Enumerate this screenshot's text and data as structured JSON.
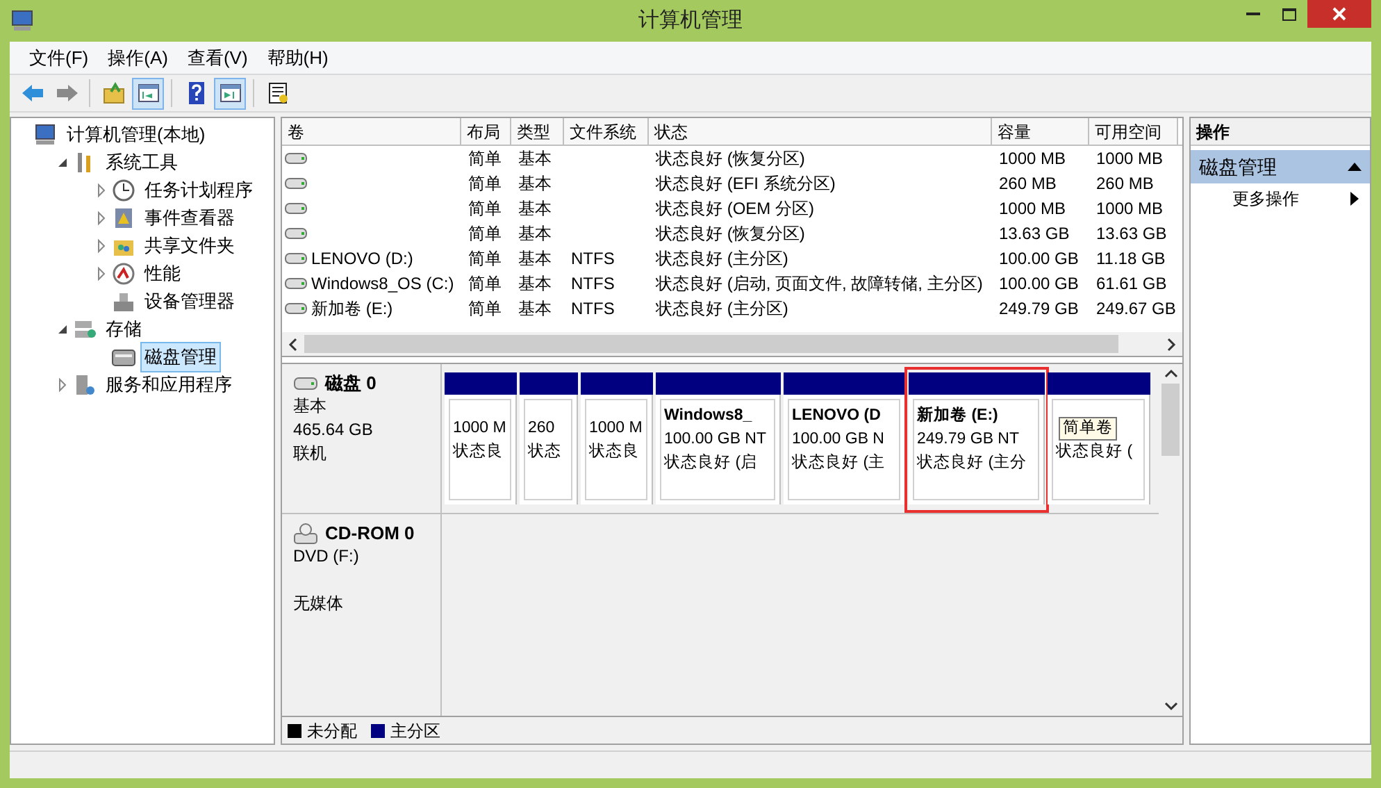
{
  "window": {
    "title": "计算机管理"
  },
  "menu": [
    "文件(F)",
    "操作(A)",
    "查看(V)",
    "帮助(H)"
  ],
  "toolbar": [
    {
      "kind": "back",
      "pressed": false
    },
    {
      "kind": "forward",
      "pressed": false
    },
    {
      "kind": "sep"
    },
    {
      "kind": "up",
      "pressed": false
    },
    {
      "kind": "tree",
      "pressed": true
    },
    {
      "kind": "sep"
    },
    {
      "kind": "help",
      "pressed": false
    },
    {
      "kind": "pane",
      "pressed": true
    },
    {
      "kind": "sep"
    },
    {
      "kind": "export",
      "pressed": false
    }
  ],
  "tree": [
    {
      "label": "计算机管理(本地)",
      "selected": false,
      "children": [
        {
          "label": "系统工具",
          "selected": false,
          "expanded": true,
          "children": [
            {
              "label": "任务计划程序",
              "selected": false,
              "expanded": false
            },
            {
              "label": "事件查看器",
              "selected": false,
              "expanded": false
            },
            {
              "label": "共享文件夹",
              "selected": false,
              "expanded": false
            },
            {
              "label": "性能",
              "selected": false,
              "expanded": false
            },
            {
              "label": "设备管理器",
              "selected": false
            }
          ]
        },
        {
          "label": "存储",
          "selected": false,
          "expanded": true,
          "children": [
            {
              "label": "磁盘管理",
              "selected": true
            }
          ]
        },
        {
          "label": "服务和应用程序",
          "selected": false,
          "expanded": false
        }
      ]
    }
  ],
  "volumes": {
    "columns": [
      "卷",
      "布局",
      "类型",
      "文件系统",
      "状态",
      "容量",
      "可用空间"
    ],
    "rows": [
      [
        "",
        "简单",
        "基本",
        "",
        "状态良好 (恢复分区)",
        "1000 MB",
        "1000 MB"
      ],
      [
        "",
        "简单",
        "基本",
        "",
        "状态良好 (EFI 系统分区)",
        "260 MB",
        "260 MB"
      ],
      [
        "",
        "简单",
        "基本",
        "",
        "状态良好 (OEM 分区)",
        "1000 MB",
        "1000 MB"
      ],
      [
        "",
        "简单",
        "基本",
        "",
        "状态良好 (恢复分区)",
        "13.63 GB",
        "13.63 GB"
      ],
      [
        "LENOVO (D:)",
        "简单",
        "基本",
        "NTFS",
        "状态良好 (主分区)",
        "100.00 GB",
        "11.18 GB"
      ],
      [
        "Windows8_OS (C:)",
        "简单",
        "基本",
        "NTFS",
        "状态良好 (启动, 页面文件, 故障转储, 主分区)",
        "100.00 GB",
        "61.61 GB"
      ],
      [
        "新加卷 (E:)",
        "简单",
        "基本",
        "NTFS",
        "状态良好 (主分区)",
        "249.79 GB",
        "249.67 GB"
      ]
    ]
  },
  "disks": [
    {
      "kind": "hdd",
      "name": "磁盘 0",
      "type": "基本",
      "size": "465.64 GB",
      "status": "联机",
      "partitions": [
        {
          "size": "1000 M",
          "status": "状态良",
          "highlighted": false
        },
        {
          "size": "260",
          "status": "状态",
          "highlighted": false
        },
        {
          "size": "1000 M",
          "status": "状态良",
          "highlighted": false
        },
        {
          "name": "Windows8_",
          "size": "100.00 GB NT",
          "status": "状态良好 (启",
          "highlighted": false
        },
        {
          "name": "LENOVO (D",
          "size": "100.00 GB N",
          "status": "状态良好 (主",
          "highlighted": false
        },
        {
          "name": "新加卷 (E:)",
          "size": "249.79 GB NT",
          "status": "状态良好 (主分",
          "highlighted": true
        },
        {
          "status": "状态良好 (",
          "highlighted": false,
          "tooltip": "简单卷"
        }
      ]
    },
    {
      "kind": "cdrom",
      "name": "CD-ROM 0",
      "type": "DVD (F:)",
      "status": "无媒体"
    }
  ],
  "legend": [
    {
      "label": "未分配",
      "color": "#000000"
    },
    {
      "label": "主分区",
      "color": "#000080"
    }
  ],
  "actions": {
    "title": "操作",
    "section": "磁盘管理",
    "items": [
      "更多操作"
    ]
  }
}
